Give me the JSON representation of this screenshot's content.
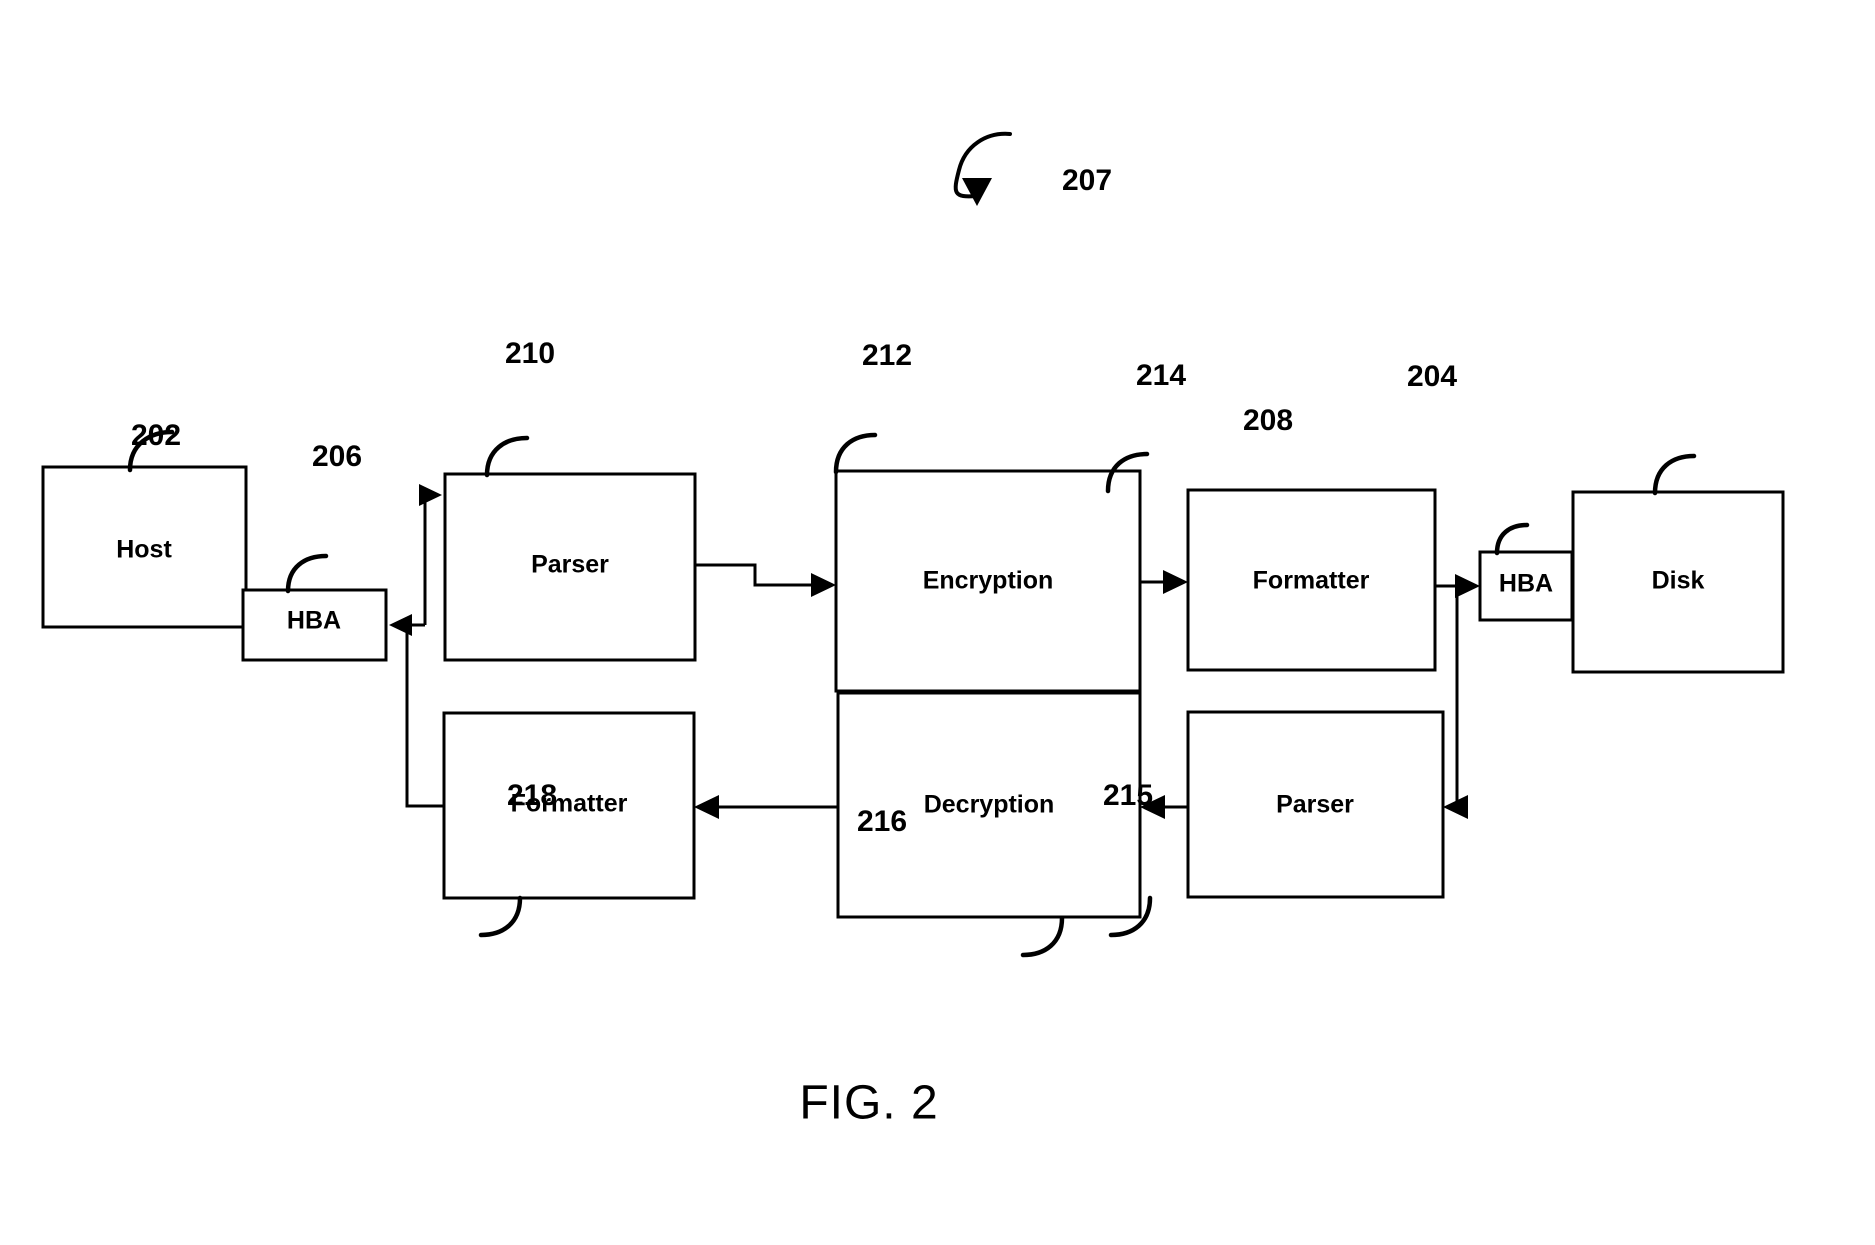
{
  "figure": {
    "caption": "FIG. 2",
    "overall_ref": "207"
  },
  "blocks": [
    {
      "id": "host",
      "label": "Host",
      "ref": "202"
    },
    {
      "id": "hba_host",
      "label": "HBA",
      "ref": "206"
    },
    {
      "id": "parser_top",
      "label": "Parser",
      "ref": "210"
    },
    {
      "id": "encryption",
      "label": "Encryption",
      "ref": "212"
    },
    {
      "id": "formatter_top",
      "label": "Formatter",
      "ref": "214"
    },
    {
      "id": "hba_disk",
      "label": "HBA",
      "ref": "208"
    },
    {
      "id": "disk",
      "label": "Disk",
      "ref": "204"
    },
    {
      "id": "formatter_bot",
      "label": "Formatter",
      "ref": "218"
    },
    {
      "id": "decryption",
      "label": "Decryption",
      "ref": "216"
    },
    {
      "id": "parser_bot",
      "label": "Parser",
      "ref": "215"
    }
  ],
  "refs": {
    "r202": "202",
    "r206": "206",
    "r210": "210",
    "r212": "212",
    "r214": "214",
    "r208": "208",
    "r204": "204",
    "r218": "218",
    "r216": "216",
    "r215": "215",
    "r207": "207"
  },
  "labels": {
    "host": "Host",
    "hba_host": "HBA",
    "parser_top": "Parser",
    "encryption": "Encryption",
    "formatter_top": "Formatter",
    "hba_disk": "HBA",
    "disk": "Disk",
    "formatter_bot": "Formatter",
    "decryption": "Decryption",
    "parser_bot": "Parser"
  },
  "colors": {
    "ink": "#000000",
    "paper": "#ffffff"
  }
}
